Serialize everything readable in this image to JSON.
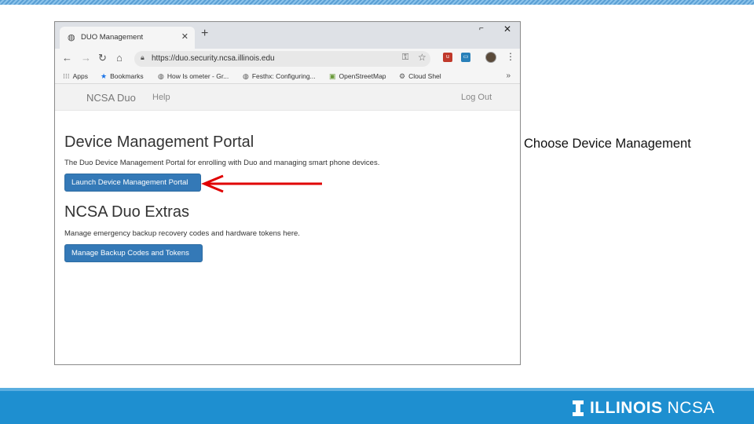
{
  "slide": {
    "note": "Choose Device Management",
    "footer": {
      "illinois": "ILLINOIS",
      "ncsa": "NCSA"
    }
  },
  "browser": {
    "tab": {
      "title": "DUO Management",
      "favicon": "globe-icon"
    },
    "window_controls": {
      "minimize": "⌐",
      "close": "✕"
    },
    "url": "https://duo.security.ncsa.illinois.edu",
    "bookmarks": [
      {
        "label": "Apps",
        "icon": "apps-grid-icon"
      },
      {
        "label": "Bookmarks",
        "icon": "star-icon"
      },
      {
        "label": "How Is ometer - Gr...",
        "icon": "globe-icon"
      },
      {
        "label": "Festhx: Configuring...",
        "icon": "globe-icon"
      },
      {
        "label": "OpenStreetMap",
        "icon": "map-icon"
      },
      {
        "label": "Cloud Shel",
        "icon": "gear-icon"
      }
    ],
    "bookmarks_more": "»"
  },
  "site": {
    "brand": "NCSA Duo",
    "help": "Help",
    "logout": "Log Out",
    "device_portal": {
      "heading": "Device Management Portal",
      "description": "The Duo Device Management Portal for enrolling with Duo and managing smart phone devices.",
      "button": "Launch Device Management Portal"
    },
    "extras": {
      "heading": "NCSA Duo Extras",
      "description": "Manage emergency backup recovery codes and hardware tokens here.",
      "button": "Manage Backup Codes and Tokens"
    }
  },
  "colors": {
    "primary_button": "#3479b7",
    "annotation_arrow": "#e00000",
    "footer": "#1e8fd0"
  }
}
